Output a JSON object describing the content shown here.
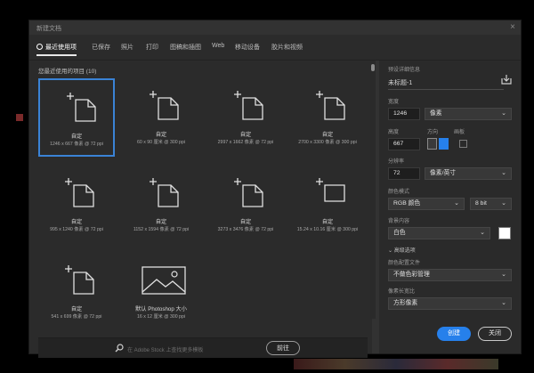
{
  "window": {
    "title": "新建文档",
    "close": "×"
  },
  "tabs": [
    {
      "label": "最近使用项",
      "active": true
    },
    {
      "label": "已保存"
    },
    {
      "label": "照片"
    },
    {
      "label": "打印"
    },
    {
      "label": "图稿和插图"
    },
    {
      "label": "Web"
    },
    {
      "label": "移动设备"
    },
    {
      "label": "胶片和视频"
    }
  ],
  "recent": {
    "title": "您最近使用的项目 (10)",
    "items": [
      {
        "name": "自定",
        "detail": "1246 x 667 像素 @ 72 ppi",
        "selected": true
      },
      {
        "name": "自定",
        "detail": "60 x 90 厘米 @ 300 ppi"
      },
      {
        "name": "自定",
        "detail": "2997 x 1662 像素 @ 72 ppi"
      },
      {
        "name": "自定",
        "detail": "2700 x 3300 像素 @ 300 ppi"
      },
      {
        "name": "自定",
        "detail": "995 x 1240 像素 @ 72 ppi"
      },
      {
        "name": "自定",
        "detail": "1152 x 1594 像素 @ 72 ppi"
      },
      {
        "name": "自定",
        "detail": "3273 x 3476 像素 @ 72 ppi"
      },
      {
        "name": "自定",
        "detail": "15.24 x 10.16 厘米 @ 300 ppi"
      },
      {
        "name": "自定",
        "detail": "541 x 699 像素 @ 72 ppi"
      },
      {
        "name": "默认 Photoshop 大小",
        "detail": "16 x 12 厘米 @ 300 ppi",
        "preset": true
      }
    ]
  },
  "search": {
    "placeholder": "在 Adobe Stock 上查找更多模板",
    "button": "前往"
  },
  "details": {
    "header": "预设详细信息",
    "doc_name": "未标题-1",
    "width_label": "宽度",
    "width_value": "1246",
    "width_unit": "像素",
    "height_label": "高度",
    "height_value": "667",
    "orientation_label": "方向",
    "artboard_label": "画板",
    "resolution_label": "分辨率",
    "resolution_value": "72",
    "resolution_unit": "像素/英寸",
    "color_mode_label": "颜色模式",
    "color_mode": "RGB 颜色",
    "bit_depth": "8 bit",
    "bg_label": "背景内容",
    "bg_value": "白色",
    "advanced_label": "高级选项",
    "profile_label": "颜色配置文件",
    "profile_value": "不做色彩管理",
    "pixel_ratio_label": "像素长宽比",
    "pixel_ratio_value": "方形像素"
  },
  "actions": {
    "create": "创建",
    "close": "关闭"
  },
  "colors": {
    "accent": "#2680eb",
    "selection": "#3a83d6",
    "background_swatch": "#ffffff"
  }
}
